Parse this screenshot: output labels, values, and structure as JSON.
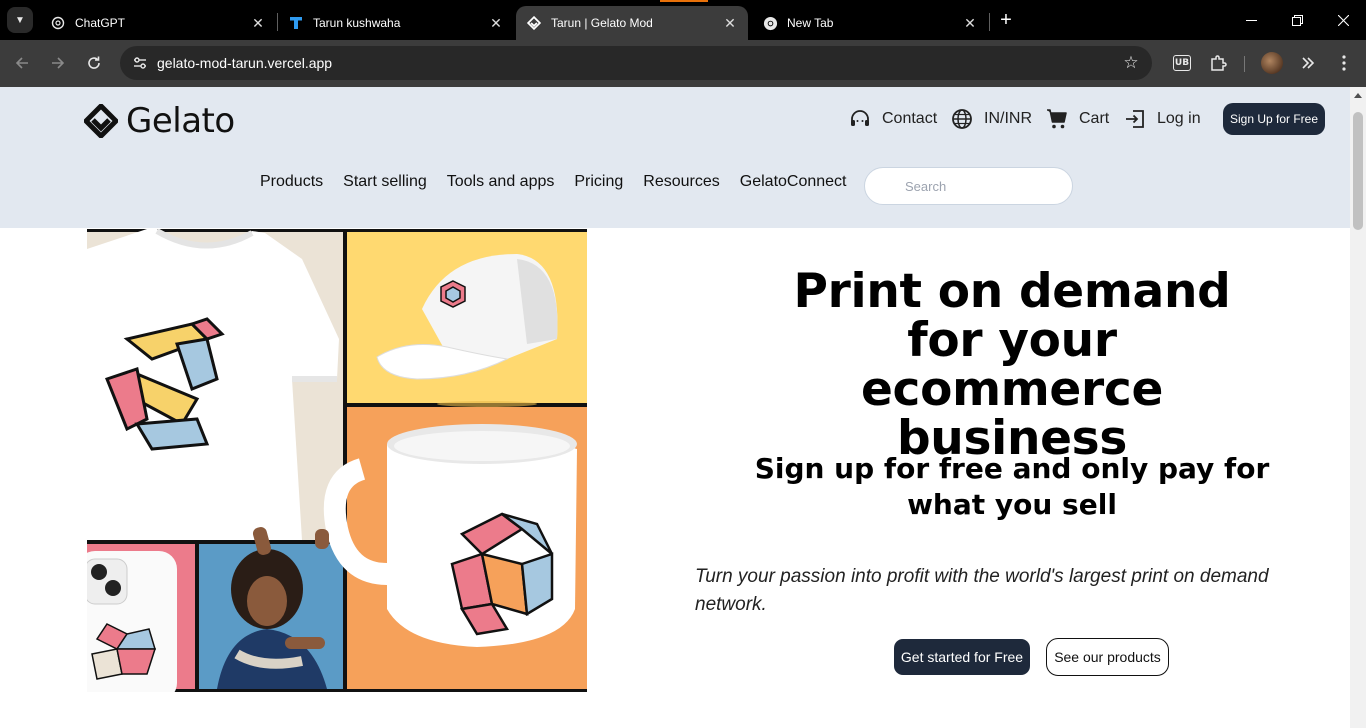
{
  "browser": {
    "tabs": [
      {
        "title": "ChatGPT",
        "icon": "chatgpt-icon"
      },
      {
        "title": "Tarun kushwaha",
        "icon": "t-logo-icon"
      },
      {
        "title": "Tarun | Gelato Mod",
        "icon": "gelato-favicon-icon",
        "active": true
      },
      {
        "title": "New Tab",
        "icon": "chrome-icon"
      }
    ],
    "url": "gelato-mod-tarun.vercel.app",
    "extension_badge": "UB"
  },
  "site": {
    "logo_text": "Gelato",
    "utility": {
      "contact": "Contact",
      "region": "IN/INR",
      "cart": "Cart",
      "login": "Log in",
      "signup": "Sign Up for Free"
    },
    "nav": [
      "Products",
      "Start selling",
      "Tools and apps",
      "Pricing",
      "Resources",
      "GelatoConnect"
    ],
    "search_placeholder": "Search"
  },
  "hero": {
    "title": "Print on demand for your ecommerce business",
    "subtitle": "Sign up for free and only pay for what you sell",
    "description": "Turn your passion into profit with the world's largest print on demand network.",
    "cta_primary": "Get started for Free",
    "cta_secondary": "See our products"
  },
  "colors": {
    "header_bg": "#e2e8f0",
    "button_dark": "#1e293b",
    "panel_beige": "#ebe3d6",
    "panel_yellow": "#ffd970",
    "panel_orange": "#f6a15a",
    "panel_pink": "#ec7b8b",
    "panel_blue": "#5b9bc6"
  }
}
